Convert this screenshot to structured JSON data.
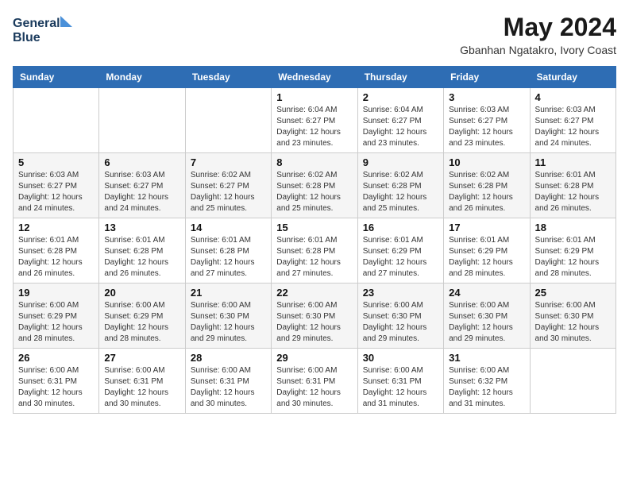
{
  "logo": {
    "line1": "General",
    "line2": "Blue"
  },
  "title": {
    "month_year": "May 2024",
    "location": "Gbanhan Ngatakro, Ivory Coast"
  },
  "days_of_week": [
    "Sunday",
    "Monday",
    "Tuesday",
    "Wednesday",
    "Thursday",
    "Friday",
    "Saturday"
  ],
  "weeks": [
    [
      {
        "day": "",
        "info": ""
      },
      {
        "day": "",
        "info": ""
      },
      {
        "day": "",
        "info": ""
      },
      {
        "day": "1",
        "info": "Sunrise: 6:04 AM\nSunset: 6:27 PM\nDaylight: 12 hours\nand 23 minutes."
      },
      {
        "day": "2",
        "info": "Sunrise: 6:04 AM\nSunset: 6:27 PM\nDaylight: 12 hours\nand 23 minutes."
      },
      {
        "day": "3",
        "info": "Sunrise: 6:03 AM\nSunset: 6:27 PM\nDaylight: 12 hours\nand 23 minutes."
      },
      {
        "day": "4",
        "info": "Sunrise: 6:03 AM\nSunset: 6:27 PM\nDaylight: 12 hours\nand 24 minutes."
      }
    ],
    [
      {
        "day": "5",
        "info": "Sunrise: 6:03 AM\nSunset: 6:27 PM\nDaylight: 12 hours\nand 24 minutes."
      },
      {
        "day": "6",
        "info": "Sunrise: 6:03 AM\nSunset: 6:27 PM\nDaylight: 12 hours\nand 24 minutes."
      },
      {
        "day": "7",
        "info": "Sunrise: 6:02 AM\nSunset: 6:27 PM\nDaylight: 12 hours\nand 25 minutes."
      },
      {
        "day": "8",
        "info": "Sunrise: 6:02 AM\nSunset: 6:28 PM\nDaylight: 12 hours\nand 25 minutes."
      },
      {
        "day": "9",
        "info": "Sunrise: 6:02 AM\nSunset: 6:28 PM\nDaylight: 12 hours\nand 25 minutes."
      },
      {
        "day": "10",
        "info": "Sunrise: 6:02 AM\nSunset: 6:28 PM\nDaylight: 12 hours\nand 26 minutes."
      },
      {
        "day": "11",
        "info": "Sunrise: 6:01 AM\nSunset: 6:28 PM\nDaylight: 12 hours\nand 26 minutes."
      }
    ],
    [
      {
        "day": "12",
        "info": "Sunrise: 6:01 AM\nSunset: 6:28 PM\nDaylight: 12 hours\nand 26 minutes."
      },
      {
        "day": "13",
        "info": "Sunrise: 6:01 AM\nSunset: 6:28 PM\nDaylight: 12 hours\nand 26 minutes."
      },
      {
        "day": "14",
        "info": "Sunrise: 6:01 AM\nSunset: 6:28 PM\nDaylight: 12 hours\nand 27 minutes."
      },
      {
        "day": "15",
        "info": "Sunrise: 6:01 AM\nSunset: 6:28 PM\nDaylight: 12 hours\nand 27 minutes."
      },
      {
        "day": "16",
        "info": "Sunrise: 6:01 AM\nSunset: 6:29 PM\nDaylight: 12 hours\nand 27 minutes."
      },
      {
        "day": "17",
        "info": "Sunrise: 6:01 AM\nSunset: 6:29 PM\nDaylight: 12 hours\nand 28 minutes."
      },
      {
        "day": "18",
        "info": "Sunrise: 6:01 AM\nSunset: 6:29 PM\nDaylight: 12 hours\nand 28 minutes."
      }
    ],
    [
      {
        "day": "19",
        "info": "Sunrise: 6:00 AM\nSunset: 6:29 PM\nDaylight: 12 hours\nand 28 minutes."
      },
      {
        "day": "20",
        "info": "Sunrise: 6:00 AM\nSunset: 6:29 PM\nDaylight: 12 hours\nand 28 minutes."
      },
      {
        "day": "21",
        "info": "Sunrise: 6:00 AM\nSunset: 6:30 PM\nDaylight: 12 hours\nand 29 minutes."
      },
      {
        "day": "22",
        "info": "Sunrise: 6:00 AM\nSunset: 6:30 PM\nDaylight: 12 hours\nand 29 minutes."
      },
      {
        "day": "23",
        "info": "Sunrise: 6:00 AM\nSunset: 6:30 PM\nDaylight: 12 hours\nand 29 minutes."
      },
      {
        "day": "24",
        "info": "Sunrise: 6:00 AM\nSunset: 6:30 PM\nDaylight: 12 hours\nand 29 minutes."
      },
      {
        "day": "25",
        "info": "Sunrise: 6:00 AM\nSunset: 6:30 PM\nDaylight: 12 hours\nand 30 minutes."
      }
    ],
    [
      {
        "day": "26",
        "info": "Sunrise: 6:00 AM\nSunset: 6:31 PM\nDaylight: 12 hours\nand 30 minutes."
      },
      {
        "day": "27",
        "info": "Sunrise: 6:00 AM\nSunset: 6:31 PM\nDaylight: 12 hours\nand 30 minutes."
      },
      {
        "day": "28",
        "info": "Sunrise: 6:00 AM\nSunset: 6:31 PM\nDaylight: 12 hours\nand 30 minutes."
      },
      {
        "day": "29",
        "info": "Sunrise: 6:00 AM\nSunset: 6:31 PM\nDaylight: 12 hours\nand 30 minutes."
      },
      {
        "day": "30",
        "info": "Sunrise: 6:00 AM\nSunset: 6:31 PM\nDaylight: 12 hours\nand 31 minutes."
      },
      {
        "day": "31",
        "info": "Sunrise: 6:00 AM\nSunset: 6:32 PM\nDaylight: 12 hours\nand 31 minutes."
      },
      {
        "day": "",
        "info": ""
      }
    ]
  ]
}
